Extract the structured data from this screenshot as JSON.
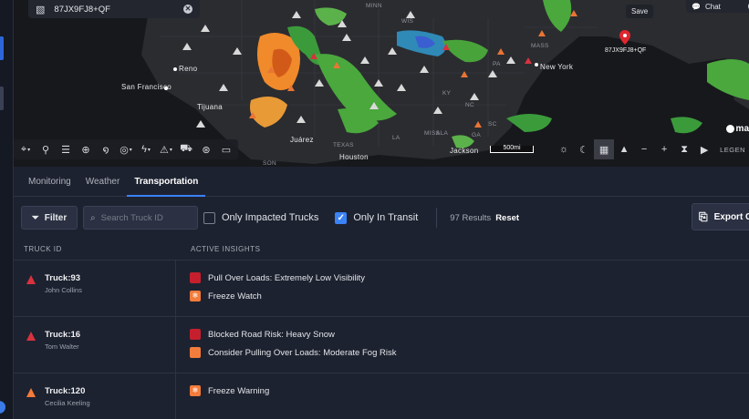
{
  "map": {
    "coord_search_value": "87JX9FJ8+QF",
    "save_tooltip": "Save",
    "pin_label": "87JX9FJ8+QF",
    "chat_label": "Chat",
    "help_glyph": "?",
    "mapbox_label": "ma",
    "scale_label": "500mi",
    "legend_label": "LEGEN",
    "cities": {
      "reno": "Reno",
      "san_francisco": "San Francisco",
      "tijuana": "Tijuana",
      "new_york": "New York",
      "houston": "Houston",
      "jacksonville": "Jackson",
      "juarez": "Juárez"
    },
    "states": {
      "minn": "MINN",
      "wis": "WIS",
      "mass": "MASS",
      "pa": "PA",
      "ky": "KY",
      "miss": "MISS",
      "ala": "ALA",
      "la": "LA",
      "ga": "GA",
      "sc": "SC",
      "texas": "TEXAS",
      "son": "SON",
      "nc": "NC"
    }
  },
  "tabs": [
    {
      "label": "Monitoring",
      "active": false
    },
    {
      "label": "Weather",
      "active": false
    },
    {
      "label": "Transportation",
      "active": true
    }
  ],
  "filters": {
    "filter_label": "Filter",
    "search_placeholder": "Search Truck ID",
    "search_value": "",
    "only_impacted_label": "Only Impacted Trucks",
    "only_impacted_checked": false,
    "only_transit_label": "Only In Transit",
    "only_transit_checked": true,
    "results_text": "97 Results",
    "reset_label": "Reset",
    "export_label": "Export C"
  },
  "table": {
    "col_truck": "TRUCK ID",
    "col_insights": "ACTIVE INSIGHTS",
    "rows": [
      {
        "truck": "Truck:93",
        "driver": "John Collins",
        "severity": "red",
        "insights": [
          {
            "text": "Pull Over Loads: Extremely Low Visibility",
            "color": "red",
            "icon": "none"
          },
          {
            "text": "Freeze Watch",
            "color": "orange",
            "icon": "snowflake-icon"
          }
        ]
      },
      {
        "truck": "Truck:16",
        "driver": "Tom Walter",
        "severity": "red",
        "insights": [
          {
            "text": "Blocked Road Risk: Heavy Snow",
            "color": "red",
            "icon": "none"
          },
          {
            "text": "Consider Pulling Over Loads: Moderate Fog Risk",
            "color": "orange",
            "icon": "none"
          }
        ]
      },
      {
        "truck": "Truck:120",
        "driver": "Cecilia Keeling",
        "severity": "orange",
        "insights": [
          {
            "text": "Freeze Warning",
            "color": "orange",
            "icon": "snowflake-icon"
          }
        ]
      }
    ]
  },
  "colors": {
    "accent": "#3b82f6",
    "severity_red": "#c51f2d",
    "severity_orange": "#f27c3b",
    "panel_bg": "#1d2230"
  }
}
